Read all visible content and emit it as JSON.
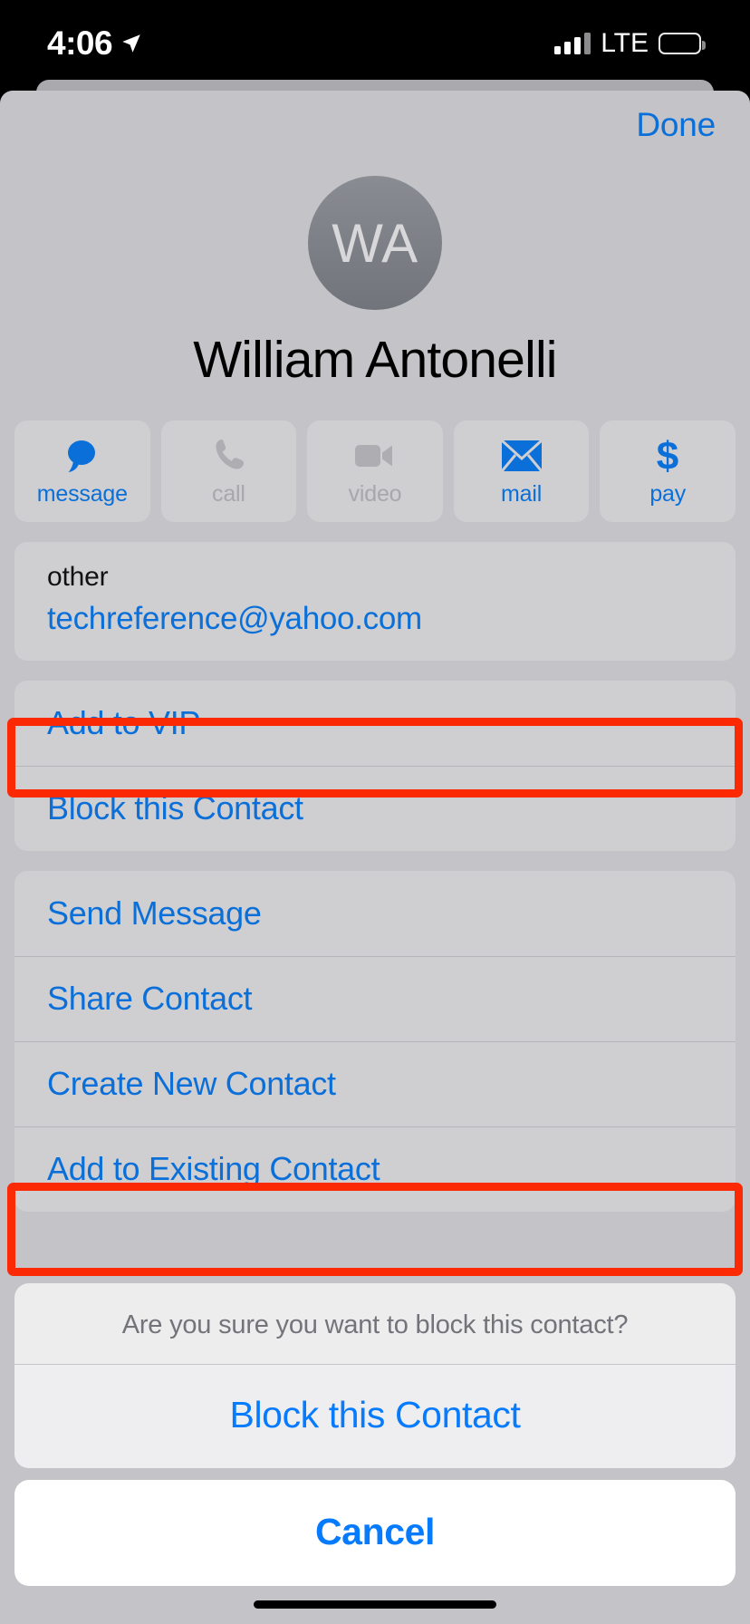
{
  "status_bar": {
    "time": "4:06",
    "location_icon": "location-arrow-icon",
    "carrier_network": "LTE",
    "signal_icon": "signal-bars-icon",
    "battery_icon": "battery-icon"
  },
  "nav": {
    "done_label": "Done"
  },
  "contact": {
    "initials": "WA",
    "name": "William Antonelli",
    "actions": [
      {
        "label": "message",
        "icon": "message-bubble-icon",
        "enabled": true
      },
      {
        "label": "call",
        "icon": "phone-icon",
        "enabled": false
      },
      {
        "label": "video",
        "icon": "video-camera-icon",
        "enabled": false
      },
      {
        "label": "mail",
        "icon": "envelope-icon",
        "enabled": true
      },
      {
        "label": "pay",
        "icon": "dollar-sign-icon",
        "enabled": true
      }
    ],
    "email": {
      "label": "other",
      "value": "techreference@yahoo.com"
    },
    "vip_group": [
      "Add to VIP",
      "Block this Contact"
    ],
    "more_group": [
      "Send Message",
      "Share Contact",
      "Create New Contact",
      "Add to Existing Contact"
    ]
  },
  "action_sheet": {
    "title": "Are you sure you want to block this contact?",
    "destructive_label": "Block this Contact",
    "cancel_label": "Cancel"
  },
  "colors": {
    "accent_blue": "#0a6fd8",
    "sheet_blue": "#067bfd",
    "highlight_red": "#fc2a04",
    "sheet_bg": "#c3c3c8",
    "card_bg": "#cfcfd2"
  }
}
